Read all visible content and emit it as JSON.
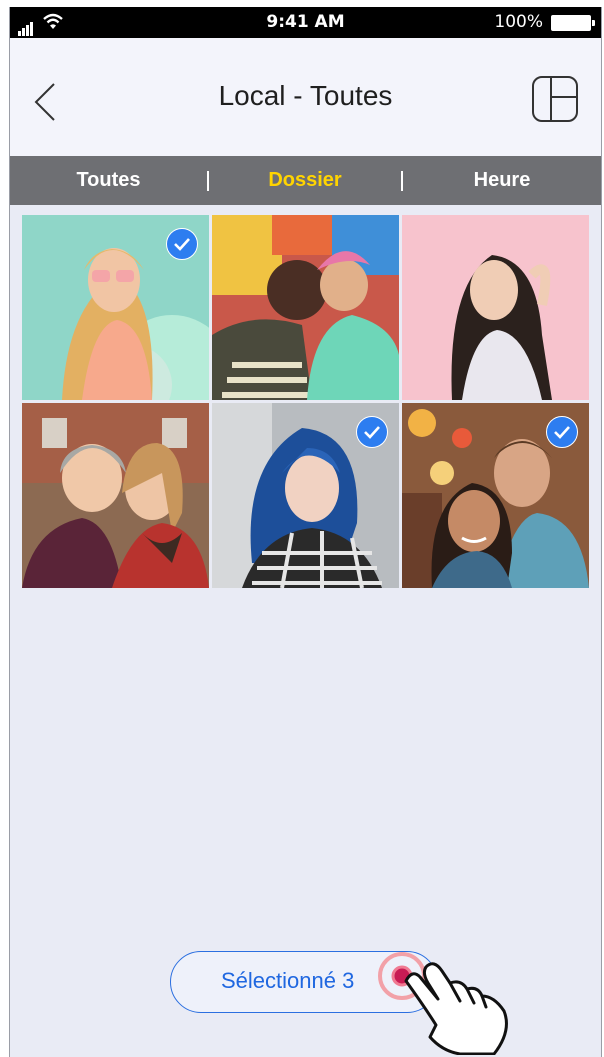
{
  "status_bar": {
    "time": "9:41 AM",
    "battery": "100%"
  },
  "header": {
    "title": "Local - Toutes",
    "back_icon": "chevron-left-icon",
    "layout_icon": "layout-grid-icon"
  },
  "tabs": [
    {
      "label": "Toutes",
      "active": false
    },
    {
      "label": "Dossier",
      "active": true
    },
    {
      "label": "Heure",
      "active": false
    }
  ],
  "photos": [
    {
      "subject": "woman-sunglasses-balloons",
      "selected": true
    },
    {
      "subject": "couple-embracing",
      "selected": false
    },
    {
      "subject": "woman-pink-background",
      "selected": false
    },
    {
      "subject": "two-friends-beanie",
      "selected": false
    },
    {
      "subject": "woman-blue-hair",
      "selected": true
    },
    {
      "subject": "couple-selfie-street",
      "selected": true
    }
  ],
  "selection_button": {
    "label": "Sélectionné 3"
  },
  "colors": {
    "accent_blue": "#2d7df0",
    "active_tab": "#ffd400",
    "tab_bar": "#6e6f73",
    "background": "#e9ebf5"
  }
}
